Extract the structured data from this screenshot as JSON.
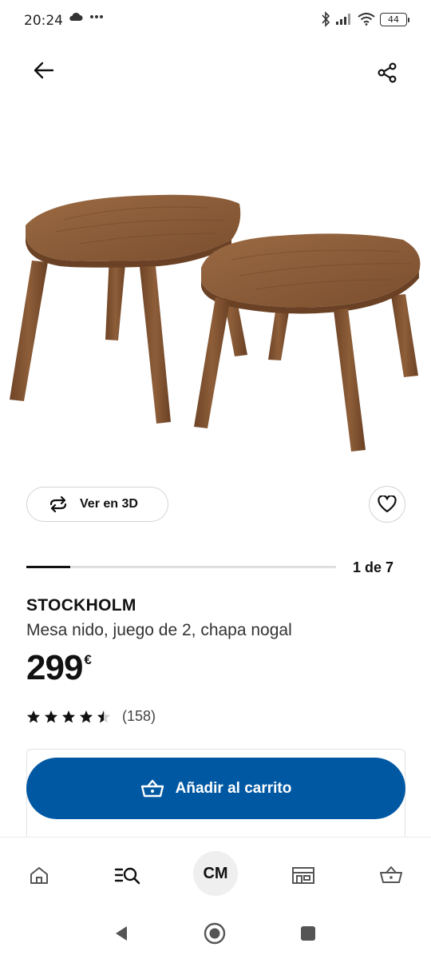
{
  "status_bar": {
    "time": "20:24",
    "left_icons": [
      "cloud-icon",
      "more-dots-icon"
    ],
    "right_icons": [
      "bluetooth-icon",
      "signal-icon",
      "wifi-icon",
      "battery-icon"
    ],
    "battery": "44"
  },
  "top_bar": {
    "back_icon": "arrow-left-icon",
    "share_icon": "share-icon"
  },
  "product_image": {
    "icon": "nesting-tables-illustration",
    "wood_color": "#8a5a36"
  },
  "actions": {
    "view_3d_label": "Ver en 3D",
    "view_3d_icon": "rotate-3d-icon",
    "favorite_icon": "heart-icon"
  },
  "gallery": {
    "current": 1,
    "total": 7,
    "counter_label": "1 de 7"
  },
  "product": {
    "name": "STOCKHOLM",
    "description": "Mesa nido, juego de 2, chapa nogal",
    "price": "299",
    "currency": "€"
  },
  "rating": {
    "stars": 4.5,
    "max_stars": 5,
    "count_label": "(158)"
  },
  "cart": {
    "add_label": "Añadir al carrito",
    "add_icon": "basket-icon",
    "button_color": "#0058a3"
  },
  "bottom_nav": {
    "items": [
      {
        "icon": "home-icon"
      },
      {
        "icon": "search-list-icon"
      },
      {
        "label": "CM"
      },
      {
        "icon": "store-icon"
      },
      {
        "icon": "basket-icon"
      }
    ]
  },
  "system_nav": {
    "items": [
      "back-triangle-icon",
      "home-circle-icon",
      "recents-square-icon"
    ]
  }
}
